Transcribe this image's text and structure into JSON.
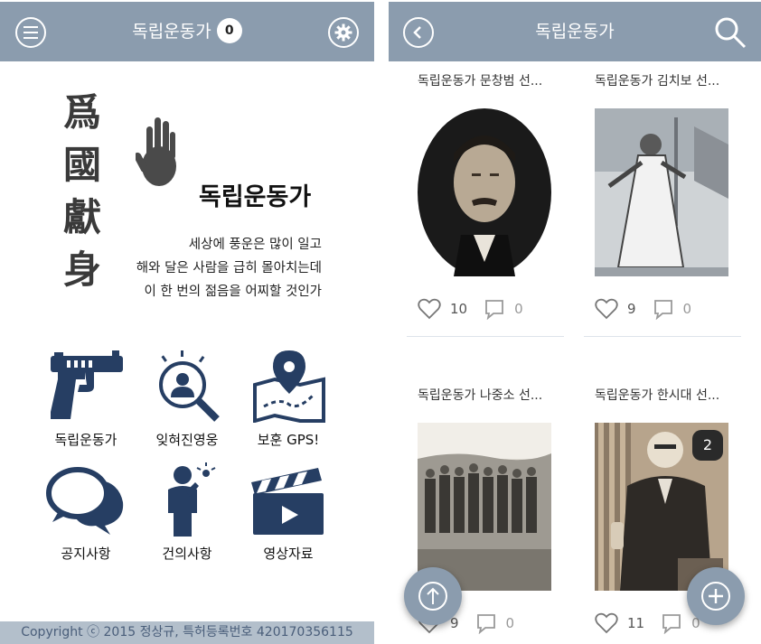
{
  "left_screen": {
    "appbar": {
      "title": "독립운동가",
      "badge_count": "0",
      "menu_icon": "menu-icon",
      "settings_icon": "gear-icon"
    },
    "hero": {
      "calligraphy": [
        "爲",
        "國",
        "獻",
        "身"
      ],
      "title": "독립운동가",
      "lines": [
        "세상에 풍운은 많이 일고",
        "해와 달은 사람을 급히 몰아치는데",
        "이 한 번의 젊음을 어찌할 것인가"
      ]
    },
    "menu": [
      {
        "label": "독립운동가",
        "icon": "pistol-icon"
      },
      {
        "label": "잊혀진영웅",
        "icon": "search-person-icon"
      },
      {
        "label": "보훈 GPS!",
        "icon": "map-pin-icon"
      },
      {
        "label": "공지사항",
        "icon": "chat-bubbles-icon"
      },
      {
        "label": "건의사항",
        "icon": "person-idea-icon"
      },
      {
        "label": "영상자료",
        "icon": "clapperboard-icon"
      }
    ],
    "footer": "Copyright ⓒ 2015 정상규, 특허등록번호 420170356115",
    "colors": {
      "appbar": "#8b9cae",
      "icon_navy": "#263e63",
      "footer_bg": "#b3bfcb"
    }
  },
  "right_screen": {
    "appbar": {
      "title": "독립운동가",
      "back_icon": "back-icon",
      "search_icon": "search-icon"
    },
    "cards": [
      {
        "title": "독립운동가 문창범 선...",
        "likes": "10",
        "comments": "0"
      },
      {
        "title": "독립운동가 김치보 선...",
        "likes": "9",
        "comments": "0"
      },
      {
        "title": "독립운동가 나중소 선...",
        "likes": "9",
        "comments": "0"
      },
      {
        "title": "독립운동가 한시대 선...",
        "likes": "11",
        "comments": "0",
        "photo_badge": "2"
      }
    ],
    "fabs": {
      "scroll_top_icon": "arrow-up-icon",
      "add_icon": "plus-icon"
    }
  }
}
